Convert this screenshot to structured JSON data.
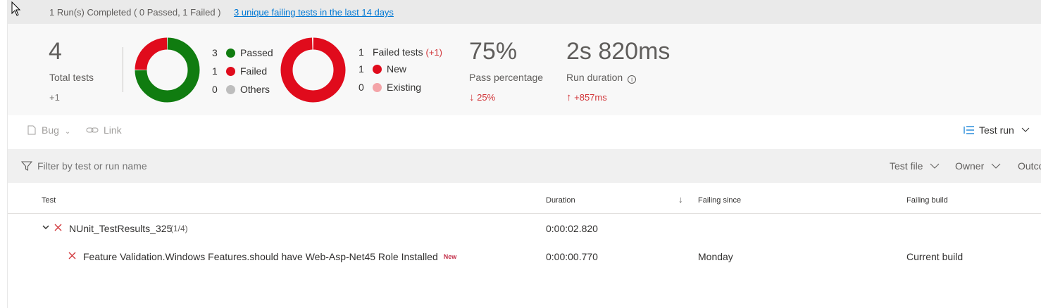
{
  "top_bar": {
    "status": "1 Run(s) Completed ( 0 Passed, 1 Failed )",
    "failing_link": "3 unique failing tests in the last 14 days"
  },
  "summary": {
    "total": {
      "value": "4",
      "label": "Total tests",
      "delta": "+1"
    },
    "outcome_legend": [
      {
        "count": "3",
        "label": "Passed",
        "color": "#107c10"
      },
      {
        "count": "1",
        "label": "Failed",
        "color": "#e00b1c"
      },
      {
        "count": "0",
        "label": "Others",
        "color": "#bdbdbd"
      }
    ],
    "failed_legend": {
      "header_count": "1",
      "header_label": "Failed tests",
      "header_delta": "(+1)",
      "items": [
        {
          "count": "1",
          "label": "New",
          "color": "#e00b1c"
        },
        {
          "count": "0",
          "label": "Existing",
          "color": "#f4a4a8"
        }
      ]
    },
    "pass_percentage": {
      "value": "75%",
      "label": "Pass percentage",
      "delta": "25%"
    },
    "run_duration": {
      "value": "2s 820ms",
      "label": "Run duration",
      "delta": "+857ms"
    }
  },
  "chart_data": [
    {
      "type": "pie",
      "categories": [
        "Passed",
        "Failed",
        "Others"
      ],
      "values": [
        3,
        1,
        0
      ],
      "colors": [
        "#107c10",
        "#e00b1c",
        "#bdbdbd"
      ]
    },
    {
      "type": "pie",
      "categories": [
        "New",
        "Existing"
      ],
      "values": [
        1,
        0
      ],
      "colors": [
        "#e00b1c",
        "#f4a4a8"
      ]
    }
  ],
  "toolbar": {
    "bug": "Bug",
    "link": "Link",
    "test_run": "Test run"
  },
  "filter": {
    "placeholder": "Filter by test or run name",
    "test_file": "Test file",
    "owner": "Owner",
    "outcome": "Outco"
  },
  "table": {
    "columns": {
      "test": "Test",
      "duration": "Duration",
      "failing_since": "Failing since",
      "failing_build": "Failing build"
    },
    "group": {
      "name": "NUnit_TestResults_325",
      "count": "(1/4)",
      "duration": "0:00:02.820"
    },
    "rows": [
      {
        "name": "Feature Validation.Windows Features.should have Web-Asp-Net45 Role Installed",
        "badge": "New",
        "duration": "0:00:00.770",
        "failing_since": "Monday",
        "failing_build": "Current build"
      }
    ]
  },
  "colors": {
    "accent": "#0078d4",
    "failed": "#e00b1c",
    "passed": "#107c10",
    "negative_delta": "#d13438"
  }
}
